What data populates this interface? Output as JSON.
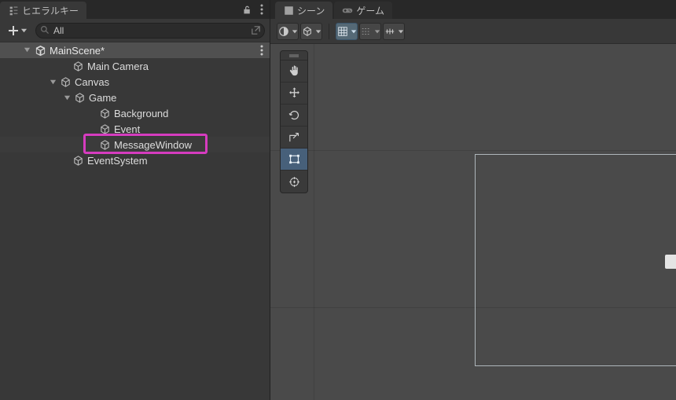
{
  "hierarchy": {
    "tab_label": "ヒエラルキー",
    "search": {
      "value": "All",
      "placeholder": ""
    },
    "scene_name": "MainScene*",
    "tree": {
      "main_camera": "Main Camera",
      "canvas": "Canvas",
      "game": "Game",
      "background": "Background",
      "event": "Event",
      "message_window": "MessageWindow",
      "event_system": "EventSystem"
    },
    "selected_node": "MessageWindow"
  },
  "scene": {
    "tabs": {
      "scene": "シーン",
      "game": "ゲーム"
    },
    "active_tab": "scene",
    "tool_column_active": "rect"
  },
  "icons": {
    "hierarchy": "hierarchy-icon",
    "lock": "lock-open-icon",
    "kebab": "kebab-icon",
    "plus": "plus-icon",
    "caret_down": "caret-down-icon",
    "search": "search-icon",
    "popout": "popout-icon",
    "unity": "unity-logo-icon",
    "cube": "gameobject-cube-icon",
    "foldout_down": "foldout-down-icon",
    "grid_tab": "grid-tab-icon",
    "gamepad": "gamepad-icon",
    "shading": "shading-mode-icon",
    "iso": "2d-3d-toggle-icon",
    "snap_grid": "snap-grid-icon",
    "snap_inc": "snap-increment-icon",
    "snap_vertex": "snap-vertex-icon",
    "hand": "hand-tool-icon",
    "move": "move-tool-icon",
    "rotate": "rotate-tool-icon",
    "scale": "scale-tool-icon",
    "rect": "rect-tool-icon",
    "transform": "transform-tool-icon"
  },
  "colors": {
    "highlight": "#d63cbf",
    "active_tool": "#47607a"
  }
}
